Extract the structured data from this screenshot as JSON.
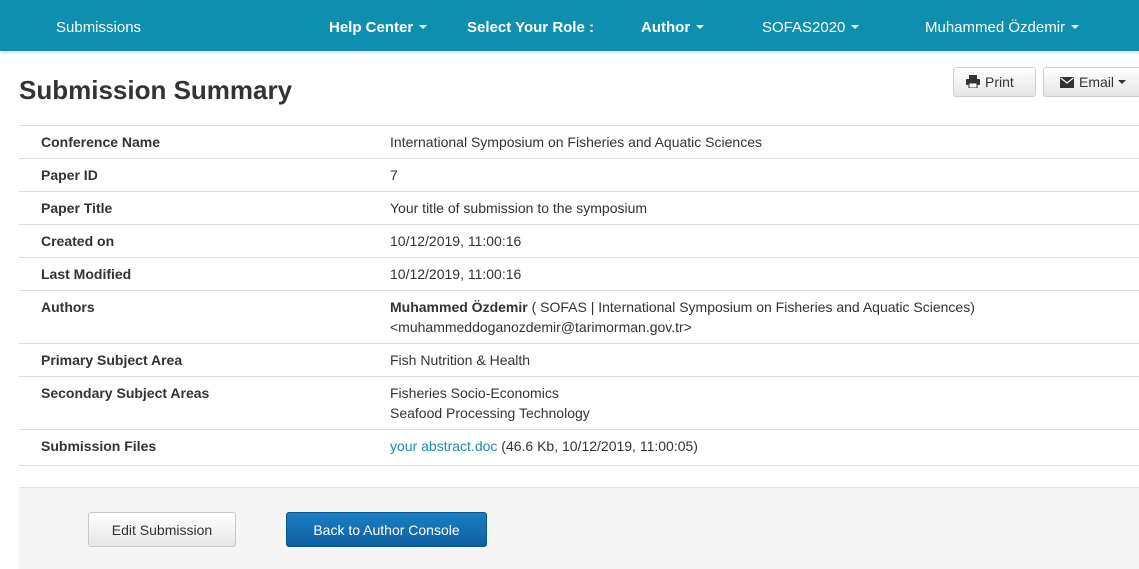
{
  "navbar": {
    "submissions": "Submissions",
    "help_center": "Help Center",
    "select_role_label": "Select Your Role :",
    "role": "Author",
    "conference": "SOFAS2020",
    "user": "Muhammed Özdemir"
  },
  "page": {
    "title": "Submission Summary",
    "print_label": "Print",
    "email_label": "Email"
  },
  "summary": {
    "conference_name": {
      "label": "Conference Name",
      "value": "International Symposium on Fisheries and Aquatic Sciences"
    },
    "paper_id": {
      "label": "Paper ID",
      "value": "7"
    },
    "paper_title": {
      "label": "Paper Title",
      "value": "Your title of submission to the symposium"
    },
    "created_on": {
      "label": "Created on",
      "value": "10/12/2019, 11:00:16"
    },
    "last_modified": {
      "label": "Last Modified",
      "value": "10/12/2019, 11:00:16"
    },
    "authors": {
      "label": "Authors",
      "name": "Muhammed Özdemir",
      "affiliation": " ( SOFAS | International Symposium on Fisheries and Aquatic Sciences)",
      "email": "<muhammeddoganozdemir@tarimorman.gov.tr>"
    },
    "primary_subject_area": {
      "label": "Primary Subject Area",
      "value": "Fish Nutrition & Health"
    },
    "secondary_subject_areas": {
      "label": "Secondary Subject Areas",
      "values": [
        "Fisheries Socio-Economics",
        "Seafood Processing Technology"
      ]
    },
    "submission_files": {
      "label": "Submission Files",
      "file_name": "your abstract.doc",
      "file_info": " (46.6 Kb, 10/12/2019, 11:00:05)"
    }
  },
  "footer": {
    "edit_label": "Edit Submission",
    "back_label": "Back to Author Console"
  },
  "colors": {
    "navbar": "#0f8fb0",
    "link": "#1a8bb3",
    "primary_button": "#1272b6"
  },
  "icons": {
    "print": "printer-icon",
    "email": "envelope-icon"
  }
}
